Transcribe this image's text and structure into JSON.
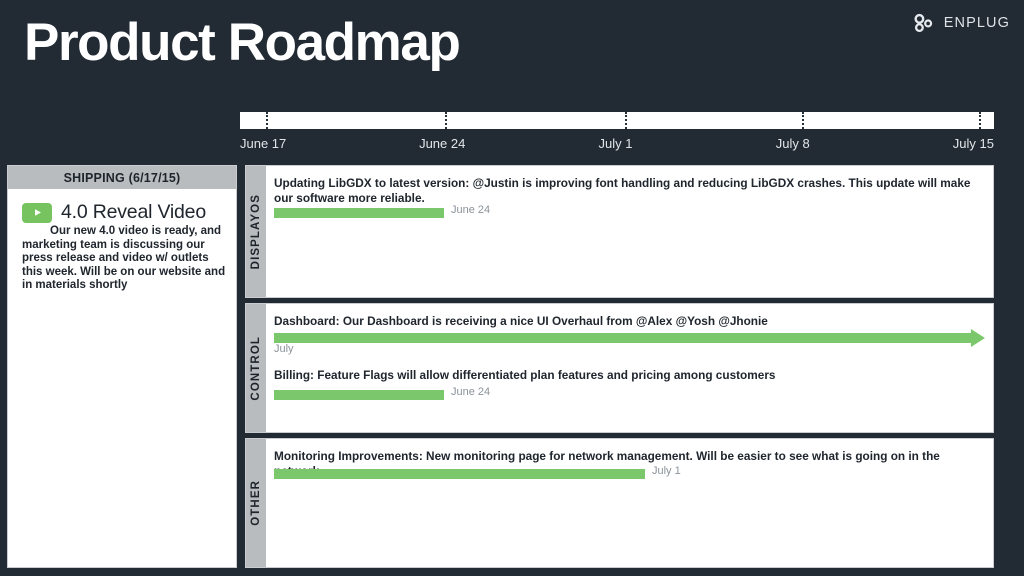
{
  "header": {
    "title": "Product Roadmap",
    "brand_name": "ENPLUG",
    "brand_icon": "enplug-logo-icon",
    "background_color": "#222a33"
  },
  "timeline": {
    "ticks": [
      {
        "label": "June 17",
        "pos_pct": 0
      },
      {
        "label": "June 24",
        "pos_pct": 27.2
      },
      {
        "label": "July 1",
        "pos_pct": 51.0
      },
      {
        "label": "July 8",
        "pos_pct": 74.5
      },
      {
        "label": "July 15",
        "pos_pct": 98.0
      }
    ]
  },
  "shipping": {
    "header": "SHIPPING (6/17/15)",
    "item": {
      "icon": "play-button-icon",
      "title": "4.0 Reveal Video",
      "description": "Our new 4.0 video is ready, and marketing team is discussing our press release and video w/ outlets this week. Will be on our website and in materials shortly"
    }
  },
  "lanes": [
    {
      "label": "DISPLAYOS",
      "tasks": [
        {
          "lead": "Updating LibGDX to latest version:",
          "body": " @Justin is improving font handling and reducing LibGDX crashes. This update will make our software more reliable.",
          "bar_date": "June 24",
          "bar_has_arrow": false
        }
      ]
    },
    {
      "label": "CONTROL",
      "tasks": [
        {
          "lead": "Dashboard:",
          "body": " Our Dashboard is receiving a nice UI Overhaul from @Alex @Yosh @Jhonie",
          "bar_date": "July",
          "bar_has_arrow": true
        },
        {
          "lead": "Billing:",
          "body": " Feature Flags will allow differentiated plan features and pricing among customers",
          "bar_date": "June 24",
          "bar_has_arrow": false
        }
      ]
    },
    {
      "label": "OTHER",
      "tasks": [
        {
          "lead": "Monitoring Improvements:",
          "body": " New monitoring page for network management. Will be easier to see what is going on in the network.",
          "bar_date": "July 1",
          "bar_has_arrow": false
        }
      ]
    }
  ],
  "colors": {
    "background": "#222a33",
    "bar_green": "#7bc86c",
    "panel": "#ffffff",
    "lane_label_gray": "#b9bcbe",
    "date_text": "#8b9299"
  }
}
